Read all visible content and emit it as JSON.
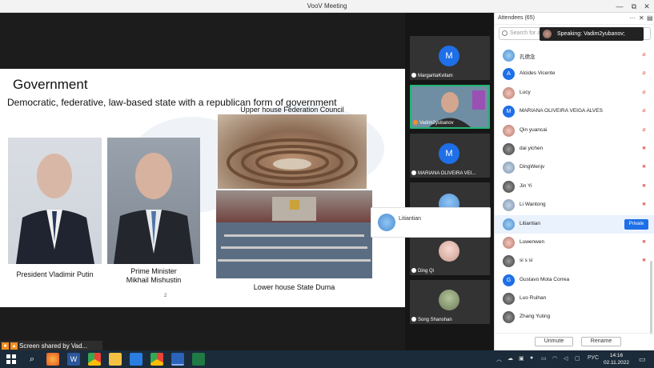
{
  "window": {
    "title": "VooV Meeting",
    "controls": {
      "minimize": "—",
      "maximize": "⧉",
      "close": "✕"
    }
  },
  "slide": {
    "title": "Government",
    "subtitle": "Democratic, federative, law-based state with a republican form of government",
    "captions": {
      "putin": "President Vladimir Putin",
      "pm_line1": "Prime Minister",
      "pm_line2": "Mikhail Mishustin",
      "upper": "Upper house Federation Council",
      "lower": "Lower house State Duma"
    },
    "page_mark": "2"
  },
  "shared_bar": {
    "label": "Screen shared by Vad..."
  },
  "video_tiles": [
    {
      "name": "MargaritaKvitam",
      "initial": "M"
    },
    {
      "name": "Vadim2yubanov",
      "initial": ""
    },
    {
      "name": "MARIANA OLIVEIRA VEI...",
      "initial": "M"
    },
    {
      "name": "",
      "initial": ""
    },
    {
      "name": "Ding Qi",
      "initial": ""
    },
    {
      "name": "Song Shanshan",
      "initial": ""
    }
  ],
  "float_card": {
    "name": "Litiantian"
  },
  "panel": {
    "title": "Attendees (65)",
    "search_placeholder": "Search for a",
    "speaking": "Speaking: Vadim2yubanov;",
    "attendees": [
      {
        "name": "孔德念",
        "initial": "",
        "icon": "mic-off"
      },
      {
        "name": "Alcides Vicente",
        "initial": "A",
        "icon": "mic-off"
      },
      {
        "name": "Lucy",
        "initial": "",
        "icon": "mic-off"
      },
      {
        "name": "MARIANA OLIVEIRA VEIGA ALVES",
        "initial": "M",
        "icon": "mic-off"
      },
      {
        "name": "Qin yuancai",
        "initial": "",
        "icon": "mic-off"
      },
      {
        "name": "dai yichen",
        "initial": "",
        "icon": "cam-off"
      },
      {
        "name": "DingWenjv",
        "initial": "",
        "icon": "cam-off"
      },
      {
        "name": "Jin Yi",
        "initial": "",
        "icon": "cam-off"
      },
      {
        "name": "Li Wantong",
        "initial": "",
        "icon": "cam-off"
      },
      {
        "name": "Litiantian",
        "initial": "",
        "icon": "private"
      },
      {
        "name": "Luwenwen",
        "initial": "",
        "icon": "cam-off"
      },
      {
        "name": "si s si",
        "initial": "",
        "icon": "cam-off"
      },
      {
        "name": "Gustavo Mota Correa",
        "initial": "G",
        "icon": ""
      },
      {
        "name": "Luo Ruihan",
        "initial": "",
        "icon": ""
      },
      {
        "name": "Zhang Yuting",
        "initial": "",
        "icon": ""
      }
    ],
    "private_label": "Private",
    "unmute_label": "Unmute",
    "rename_label": "Rename"
  },
  "taskbar": {
    "lang": "РУС",
    "time": "14:16",
    "date": "02.11.2022"
  },
  "colors": {
    "accent": "#1e6fe8",
    "active_border": "#22b573",
    "muted": "#e05a5a"
  }
}
